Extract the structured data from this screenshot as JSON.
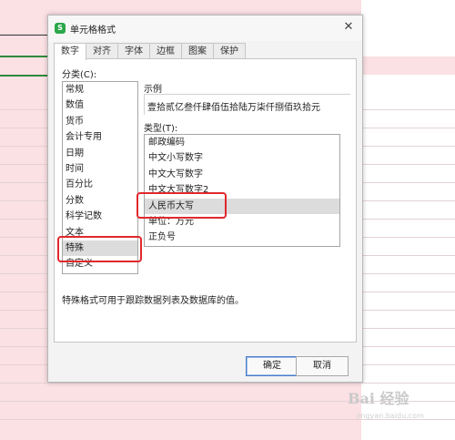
{
  "dialog": {
    "app_icon": "S",
    "title": "单元格格式",
    "close_glyph": "✕",
    "tabs": [
      "数字",
      "对齐",
      "字体",
      "边框",
      "图案",
      "保护"
    ],
    "active_tab": "数字",
    "category_label": "分类(C):",
    "categories": [
      "常规",
      "数值",
      "货币",
      "会计专用",
      "日期",
      "时间",
      "百分比",
      "分数",
      "科学记数",
      "文本",
      "特殊",
      "自定义"
    ],
    "selected_category": "特殊",
    "sample_label": "示例",
    "sample_value": "壹拾贰亿叁仟肆佰伍拾陆万柒仟捌佰玖拾元",
    "type_label": "类型(T):",
    "types": [
      "邮政编码",
      "中文小写数字",
      "中文大写数字",
      "中文大写数字2",
      "人民币大写",
      "单位：万元",
      "正负号"
    ],
    "selected_type": "人民币大写",
    "description": "特殊格式可用于跟踪数据列表及数据库的值。",
    "ok_label": "确定",
    "cancel_label": "取消"
  },
  "watermark": {
    "brand": "Bai 经验",
    "sub": "jingyan.baidu.com"
  },
  "colors": {
    "sheet_background": "#fbe0e4",
    "highlight": "#e0282c",
    "app_icon": "#2aa84a"
  }
}
